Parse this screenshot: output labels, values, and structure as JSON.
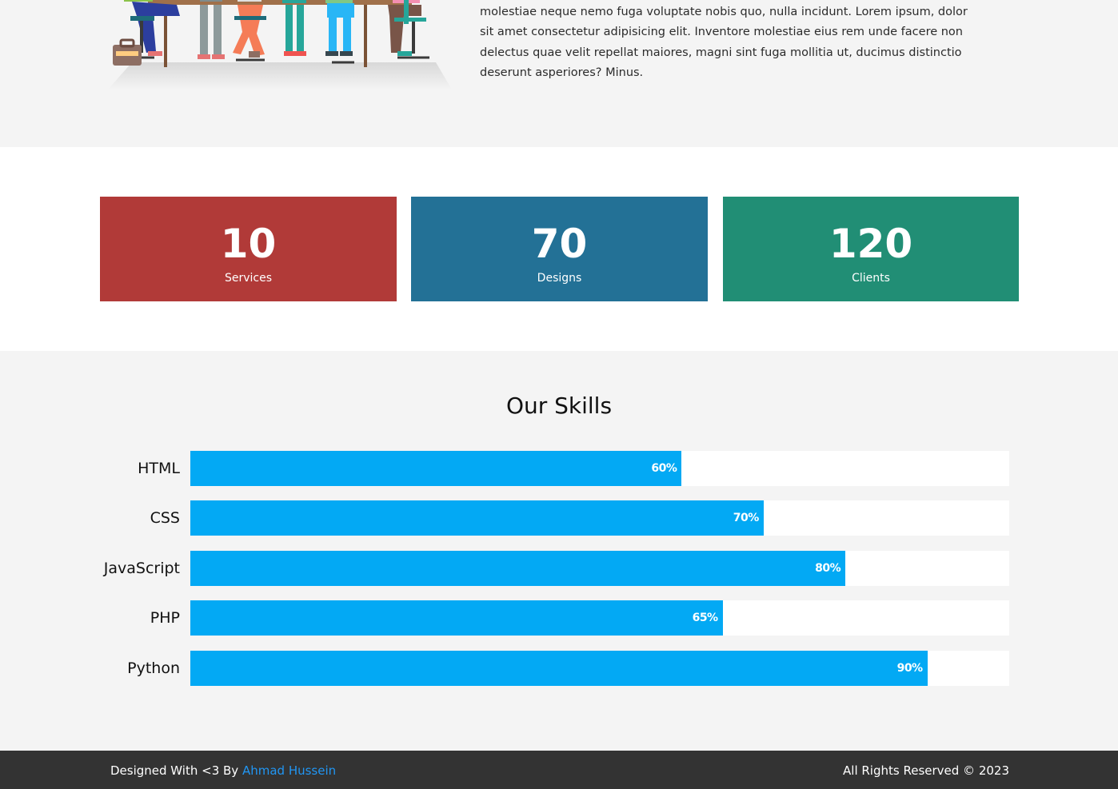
{
  "about": {
    "paragraph": "molestiae neque nemo fuga voluptate nobis quo, nulla incidunt. Lorem ipsum, dolor sit amet consectetur adipisicing elit. Inventore molestiae eius rem unde facere non delectus quae velit repellat maiores, magni sint fuga mollitia ut, ducimus distinctio deserunt asperiores? Minus."
  },
  "stats": [
    {
      "number": "10",
      "label": "Services",
      "color": "#b13a38"
    },
    {
      "number": "70",
      "label": "Designs",
      "color": "#237196"
    },
    {
      "number": "120",
      "label": "Clients",
      "color": "#218e75"
    }
  ],
  "skills": {
    "title": "Our Skills",
    "bar_color": "#03a9f4",
    "items": [
      {
        "name": "HTML",
        "percent": 60,
        "label": "60%"
      },
      {
        "name": "CSS",
        "percent": 70,
        "label": "70%"
      },
      {
        "name": "JavaScript",
        "percent": 80,
        "label": "80%"
      },
      {
        "name": "PHP",
        "percent": 65,
        "label": "65%"
      },
      {
        "name": "Python",
        "percent": 90,
        "label": "90%"
      }
    ]
  },
  "footer": {
    "left_prefix": "Designed With <3 By ",
    "author_link": "Ahmad Hussein",
    "right_text": "All Rights Reserved © 2023"
  }
}
